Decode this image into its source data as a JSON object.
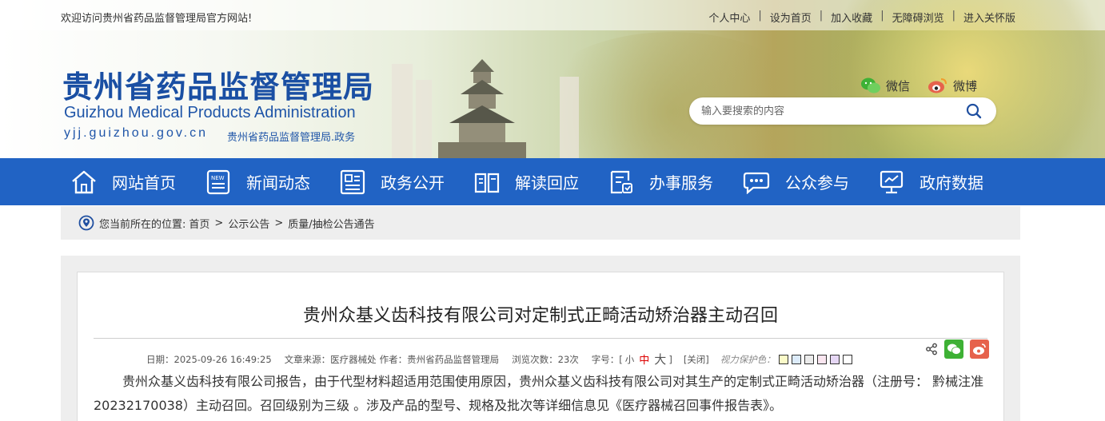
{
  "topbar": {
    "welcome": "欢迎访问贵州省药品监督管理局官方网站!",
    "links": [
      "个人中心",
      "设为首页",
      "加入收藏",
      "无障碍浏览",
      "进入关怀版"
    ]
  },
  "logo": {
    "cn": "贵州省药品监督管理局",
    "en": "Guizhou Medical Products Administration",
    "url": "yjj.guizhou.gov.cn",
    "sub": "贵州省药品监督管理局.政务"
  },
  "social": {
    "wechat": "微信",
    "weibo": "微博"
  },
  "search": {
    "placeholder": "输入要搜索的内容"
  },
  "nav": [
    {
      "label": "网站首页",
      "icon": "home-icon"
    },
    {
      "label": "新闻动态",
      "icon": "news-icon"
    },
    {
      "label": "政务公开",
      "icon": "document-icon"
    },
    {
      "label": "解读回应",
      "icon": "book-icon"
    },
    {
      "label": "办事服务",
      "icon": "service-icon"
    },
    {
      "label": "公众参与",
      "icon": "chat-icon"
    },
    {
      "label": "政府数据",
      "icon": "data-icon"
    }
  ],
  "breadcrumb": {
    "prefix": "您当前所在的位置:",
    "items": [
      "首页",
      "公示公告",
      "质量/抽检公告通告"
    ]
  },
  "article": {
    "title": "贵州众基义齿科技有限公司对定制式正畸活动矫治器主动召回",
    "date": "日期：2025-09-26 16:49:25",
    "source": "文章来源：医疗器械处",
    "author": "作者：贵州省药品监督管理局",
    "views": "浏览次数：23次",
    "font_label": "字号：[",
    "font_small": "小",
    "font_medium": "中",
    "font_large": "大",
    "font_end": "]",
    "close": "[关闭]",
    "eye_label": "视力保护色：",
    "swatch_colors": [
      "#fafac8",
      "#dcebfa",
      "#ebebeb",
      "#fae6f0",
      "#e6d7f5",
      "#ffffff"
    ],
    "body": "贵州众基义齿科技有限公司报告，由于代型材料超适用范围使用原因，贵州众基义齿科技有限公司对其生产的定制式正畸活动矫治器（注册号： 黔械注准20232170038）主动召回。召回级别为三级 。涉及产品的型号、规格及批次等详细信息见《医疗器械召回事件报告表》。"
  },
  "colors": {
    "nav_bg": "#2163c4",
    "brand_blue": "#1a4fa3",
    "wechat": "#3eb135",
    "weibo": "#e6624c"
  }
}
